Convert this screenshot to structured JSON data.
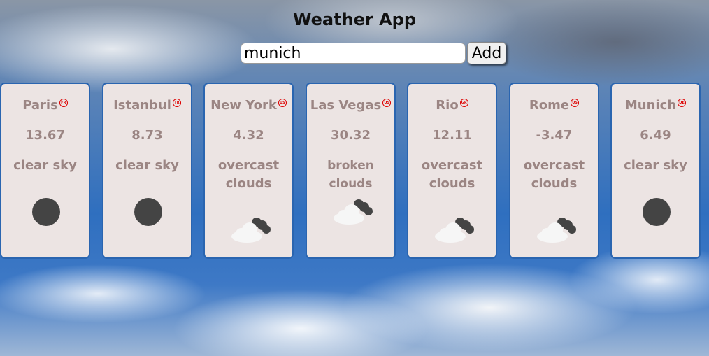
{
  "app": {
    "title": "Weather App"
  },
  "search": {
    "value": "munich",
    "add_label": "Add"
  },
  "cards": [
    {
      "city": "Paris",
      "country": "FR",
      "temp": "13.67",
      "desc": "clear sky",
      "icon": "sun-icon"
    },
    {
      "city": "Istanbul",
      "country": "TR",
      "temp": "8.73",
      "desc": "clear sky",
      "icon": "sun-icon"
    },
    {
      "city": "New York",
      "country": "US",
      "temp": "4.32",
      "desc": "overcast clouds",
      "icon": "cloud-icon"
    },
    {
      "city": "Las Vegas",
      "country": "US",
      "temp": "30.32",
      "desc": "broken clouds",
      "icon": "cloud-icon"
    },
    {
      "city": "Rio",
      "country": "GR",
      "temp": "12.11",
      "desc": "overcast clouds",
      "icon": "cloud-icon"
    },
    {
      "city": "Rome",
      "country": "US",
      "temp": "-3.47",
      "desc": "overcast clouds",
      "icon": "cloud-icon"
    },
    {
      "city": "Munich",
      "country": "DE",
      "temp": "6.49",
      "desc": "clear sky",
      "icon": "sun-icon"
    }
  ],
  "colors": {
    "card_border": "#2a65b0",
    "card_bg": "#ece4e3",
    "card_text": "#9b8583",
    "icon_dark": "#444444"
  }
}
